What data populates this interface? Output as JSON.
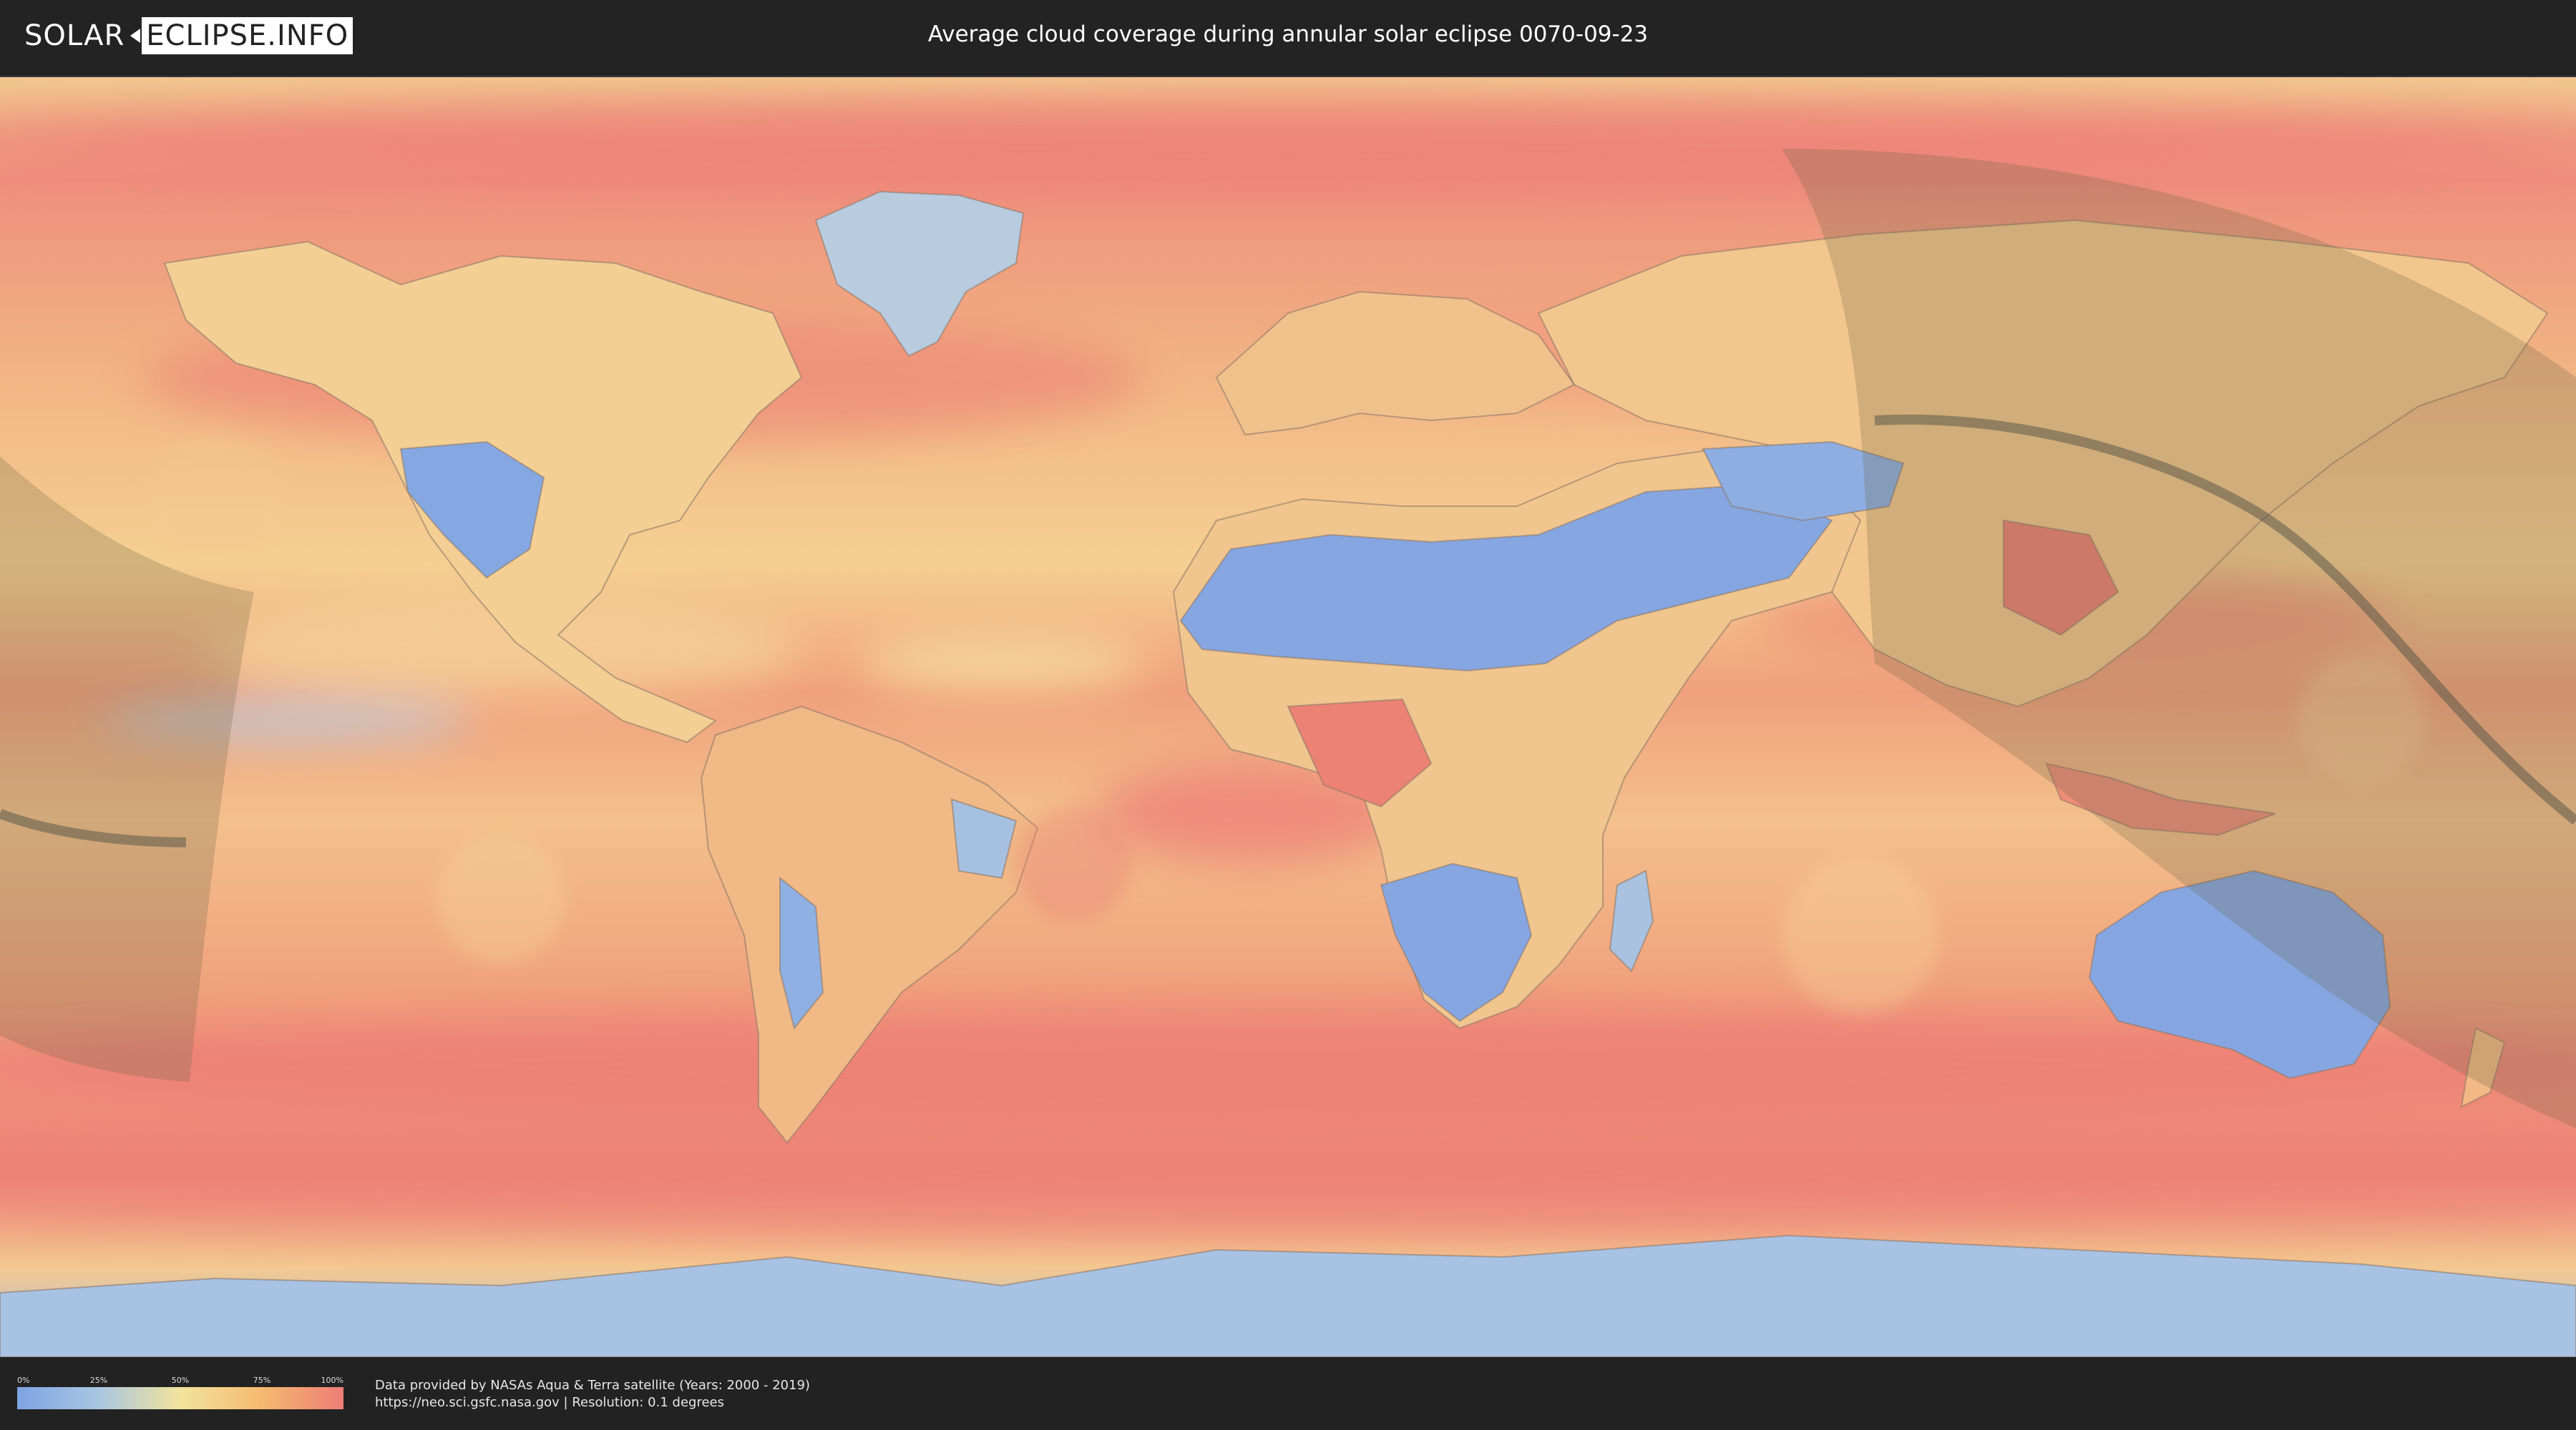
{
  "header": {
    "logo_left": "SOLAR",
    "logo_right": "ECLIPSE.INFO",
    "title": "Average cloud coverage during annular solar eclipse 0070-09-23"
  },
  "legend": {
    "ticks": [
      "0%",
      "25%",
      "50%",
      "75%",
      "100%"
    ],
    "colors": [
      "#7ea3e4",
      "#a9c6e1",
      "#f2e39c",
      "#f5b970",
      "#ed7d76"
    ]
  },
  "credit": {
    "line1": "Data provided by NASAs Aqua & Terra satellite (Years: 2000 - 2019)",
    "line2": "https://neo.sci.gsfc.nasa.gov | Resolution: 0.1 degrees"
  },
  "map": {
    "kind": "world cloud coverage, equirectangular",
    "colors": {
      "ocean": "#f2ad82",
      "clear": "#7ea3e4",
      "cloudy": "#ed7d76",
      "shadow": "#6d6245",
      "path": "#5c5a4a"
    }
  }
}
